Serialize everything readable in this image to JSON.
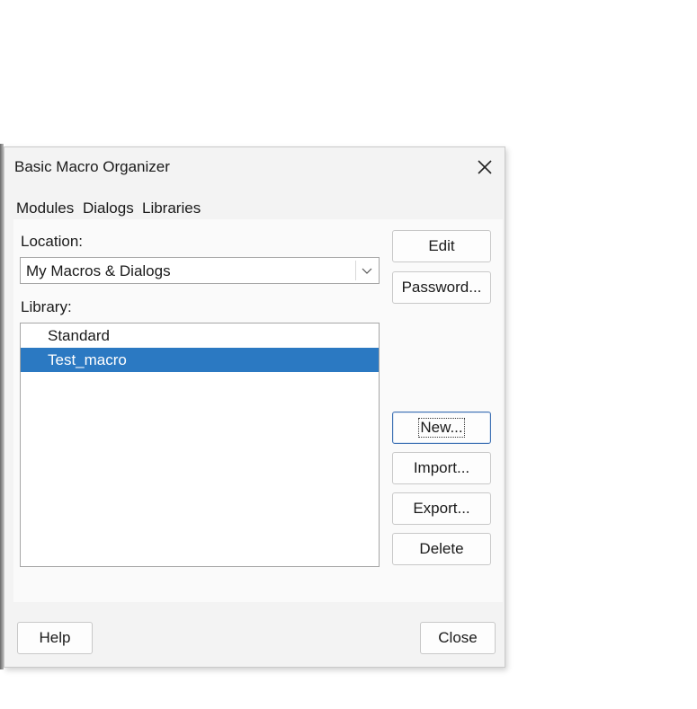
{
  "dialog": {
    "title": "Basic Macro Organizer",
    "close_icon": "close-icon"
  },
  "tabs": [
    {
      "label": "Modules"
    },
    {
      "label": "Dialogs"
    },
    {
      "label": "Libraries"
    }
  ],
  "location": {
    "label": "Location:",
    "value": "My Macros & Dialogs",
    "dropdown_icon": "chevron-down-icon"
  },
  "library": {
    "label": "Library:",
    "items": [
      {
        "label": "Standard",
        "selected": false
      },
      {
        "label": "Test_macro",
        "selected": true
      }
    ]
  },
  "buttons": {
    "edit": "Edit",
    "password": "Password...",
    "new": "New...",
    "import": "Import...",
    "export": "Export...",
    "delete": "Delete"
  },
  "footer": {
    "help": "Help",
    "close": "Close"
  },
  "colors": {
    "selection": "#2b79c2",
    "dialog_bg": "#f3f3f3"
  }
}
